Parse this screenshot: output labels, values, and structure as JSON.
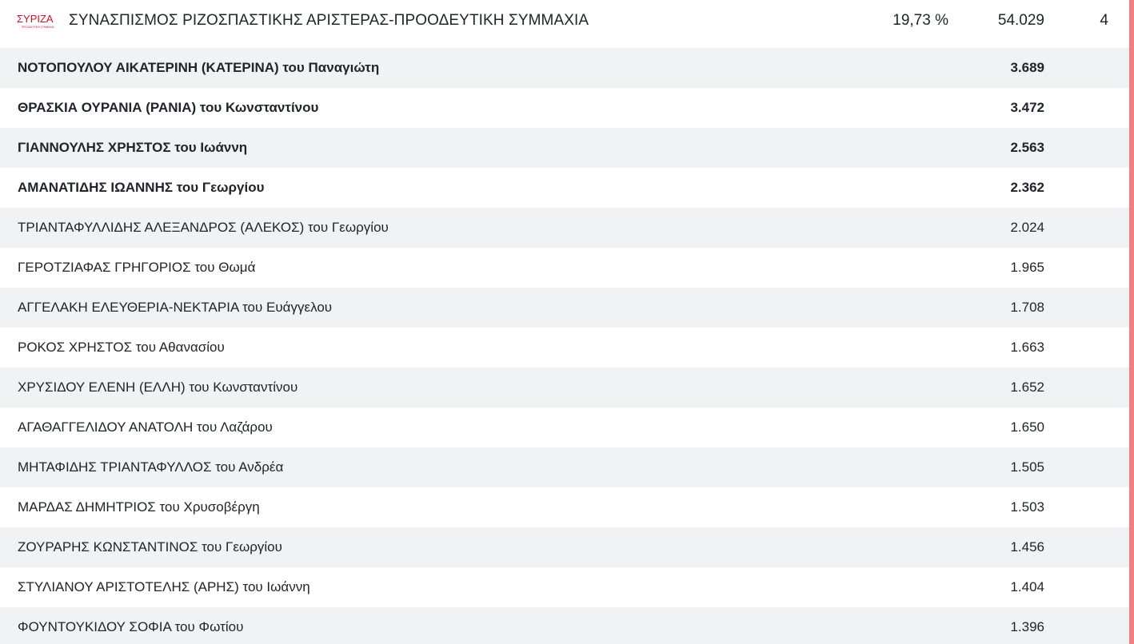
{
  "party": {
    "logo_text": "ΣΥΡΙΖΑ",
    "logo_subtext": "ΠΡΟΟΔΕΥΤΙΚΗ ΣΥΜΜΑΧΙΑ",
    "logo_color": "#c8102e",
    "name": "ΣΥΝΑΣΠΙΣΜΟΣ ΡΙΖΟΣΠΑΣΤΙΚΗΣ ΑΡΙΣΤΕΡΑΣ-ΠΡΟΟΔΕΥΤΙΚΗ ΣΥΜΜΑΧΙΑ",
    "percentage": "19,73 %",
    "votes": "54.029",
    "seats": "4"
  },
  "accent_color": "#f07f82",
  "candidates": [
    {
      "name": "ΝΟΤΟΠΟΥΛΟΥ ΑΙΚΑΤΕΡΙΝΗ (ΚΑΤΕΡΙΝΑ) του Παναγιώτη",
      "votes": "3.689",
      "elected": true
    },
    {
      "name": "ΘΡΑΣΚΙΑ ΟΥΡΑΝΙΑ (ΡΑΝΙΑ) του Κωνσταντίνου",
      "votes": "3.472",
      "elected": true
    },
    {
      "name": "ΓΙΑΝΝΟΥΛΗΣ ΧΡΗΣΤΟΣ του Ιωάννη",
      "votes": "2.563",
      "elected": true
    },
    {
      "name": "ΑΜΑΝΑΤΙΔΗΣ ΙΩΑΝΝΗΣ του Γεωργίου",
      "votes": "2.362",
      "elected": true
    },
    {
      "name": "ΤΡΙΑΝΤΑΦΥΛΛΙΔΗΣ ΑΛΕΞΑΝΔΡΟΣ (ΑΛΕΚΟΣ) του Γεωργίου",
      "votes": "2.024",
      "elected": false
    },
    {
      "name": "ΓΕΡΟΤΖΙΑΦΑΣ ΓΡΗΓΟΡΙΟΣ του Θωμά",
      "votes": "1.965",
      "elected": false
    },
    {
      "name": "ΑΓΓΕΛΑΚΗ ΕΛΕΥΘΕΡΙΑ-ΝΕΚΤΑΡΙΑ του Ευάγγελου",
      "votes": "1.708",
      "elected": false
    },
    {
      "name": "ΡΟΚΟΣ ΧΡΗΣΤΟΣ του Αθανασίου",
      "votes": "1.663",
      "elected": false
    },
    {
      "name": "ΧΡΥΣΙΔΟΥ ΕΛΕΝΗ (ΕΛΛΗ) του Κωνσταντίνου",
      "votes": "1.652",
      "elected": false
    },
    {
      "name": "ΑΓΑΘΑΓΓΕΛΙΔΟΥ ΑΝΑΤΟΛΗ του Λαζάρου",
      "votes": "1.650",
      "elected": false
    },
    {
      "name": "ΜΗΤΑΦΙΔΗΣ ΤΡΙΑΝΤΑΦΥΛΛΟΣ του Ανδρέα",
      "votes": "1.505",
      "elected": false
    },
    {
      "name": "ΜΑΡΔΑΣ ΔΗΜΗΤΡΙΟΣ του Χρυσοβέργη",
      "votes": "1.503",
      "elected": false
    },
    {
      "name": "ΖΟΥΡΑΡΗΣ ΚΩΝΣΤΑΝΤΙΝΟΣ του Γεωργίου",
      "votes": "1.456",
      "elected": false
    },
    {
      "name": "ΣΤΥΛΙΑΝΟΥ ΑΡΙΣΤΟΤΕΛΗΣ (ΑΡΗΣ) του Ιωάννη",
      "votes": "1.404",
      "elected": false
    },
    {
      "name": "ΦΟΥΝΤΟΥΚΙΔΟΥ ΣΟΦΙΑ του Φωτίου",
      "votes": "1.396",
      "elected": false
    }
  ]
}
